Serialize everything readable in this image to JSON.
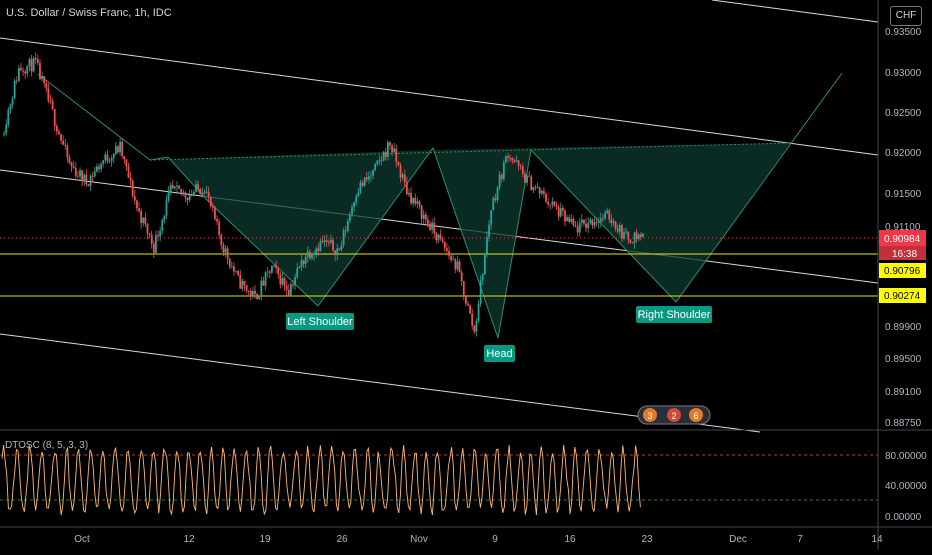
{
  "header": {
    "symbol_title": "U.S. Dollar / Swiss Franc, 1h, IDC",
    "currency": "CHF"
  },
  "colors": {
    "background": "#000000",
    "candle_up": "#26a69a",
    "candle_down": "#ef5350",
    "channel_line": "#d9d9d9",
    "pattern_stroke": "#2e8b73",
    "pattern_fill": "#0d3a2f",
    "level_line": "#e6e61a",
    "level_label": "#ffff00",
    "price_label": "#f23645",
    "pattern_label_bg": "#089981",
    "osc_line": "#ffb870",
    "osc_upper_level": "#b33a3a",
    "osc_lower_level": "#2e7d32"
  },
  "price_axis": {
    "ticks": [
      "0.93500",
      "0.93000",
      "0.92500",
      "0.92000",
      "0.91500",
      "0.91100",
      "0.89900",
      "0.89500",
      "0.89100",
      "0.88750"
    ],
    "current_price": "0.90984",
    "countdown": "16:38",
    "level_labels": [
      "0.90796",
      "0.90274"
    ]
  },
  "time_axis": {
    "ticks": [
      "Oct",
      "12",
      "19",
      "26",
      "Nov",
      "9",
      "16",
      "23",
      "Dec",
      "7",
      "14"
    ]
  },
  "pattern_labels": {
    "left_shoulder": "Left Shoulder",
    "head": "Head",
    "right_shoulder": "Right Shoulder"
  },
  "oscillator": {
    "name": "DTOSC (8, 5, 3, 3)",
    "ticks": [
      "80.00000",
      "40.00000",
      "0.00000"
    ],
    "levels": [
      80,
      20
    ]
  },
  "event_badges": [
    "3",
    "2",
    "6"
  ],
  "chart_data": {
    "type": "candlestick",
    "title": "U.S. Dollar / Swiss Franc, 1h, IDC",
    "ylim": [
      0.8871,
      0.9372
    ],
    "grid": false,
    "price_path": [
      [
        "Oct 1",
        0.9215
      ],
      [
        "Oct 2",
        0.9292
      ],
      [
        "Oct 3",
        0.9298
      ],
      [
        "Oct 5",
        0.924
      ],
      [
        "Oct 6",
        0.918
      ],
      [
        "Oct 7",
        0.916
      ],
      [
        "Oct 8",
        0.9185
      ],
      [
        "Oct 9",
        0.92
      ],
      [
        "Oct 12",
        0.913
      ],
      [
        "Oct 13",
        0.9085
      ],
      [
        "Oct 14",
        0.915
      ],
      [
        "Oct 15",
        0.9145
      ],
      [
        "Oct 16",
        0.9155
      ],
      [
        "Oct 19",
        0.909
      ],
      [
        "Oct 20",
        0.9045
      ],
      [
        "Oct 21",
        0.9025
      ],
      [
        "Oct 22",
        0.906
      ],
      [
        "Oct 23",
        0.9035
      ],
      [
        "Oct 26",
        0.9075
      ],
      [
        "Oct 27",
        0.909
      ],
      [
        "Oct 28",
        0.908
      ],
      [
        "Oct 29",
        0.915
      ],
      [
        "Oct 30",
        0.917
      ],
      [
        "Nov 2",
        0.9205
      ],
      [
        "Nov 3",
        0.915
      ],
      [
        "Nov 4",
        0.912
      ],
      [
        "Nov 5",
        0.909
      ],
      [
        "Nov 6",
        0.906
      ],
      [
        "Nov 9",
        0.8985
      ],
      [
        "Nov 10",
        0.913
      ],
      [
        "Nov 11",
        0.9195
      ],
      [
        "Nov 12",
        0.9165
      ],
      [
        "Nov 13",
        0.9145
      ],
      [
        "Nov 16",
        0.9125
      ],
      [
        "Nov 17",
        0.9105
      ],
      [
        "Nov 18",
        0.9115
      ],
      [
        "Nov 19",
        0.912
      ],
      [
        "Nov 20",
        0.9095
      ],
      [
        "Nov 23",
        0.9098
      ]
    ],
    "annotations": {
      "neckline": "upper dotted trend line through the shoulder/head tops",
      "patterns": [
        "Left Shoulder",
        "Head",
        "Right Shoulder"
      ],
      "projection": "zig-zag to 0.90274 then rally to 0.93000"
    },
    "horizontal_levels": [
      0.90796,
      0.90274
    ],
    "oscillator": {
      "name": "DTOSC (8, 5, 3, 3)",
      "ylim": [
        0,
        100
      ],
      "levels": [
        80,
        20
      ]
    }
  }
}
